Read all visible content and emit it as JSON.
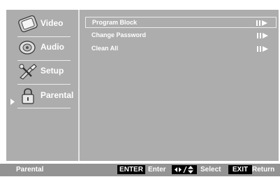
{
  "sidebar": {
    "items": [
      {
        "label": "Video",
        "icon": "tv-icon"
      },
      {
        "label": "Audio",
        "icon": "speaker-icon"
      },
      {
        "label": "Setup",
        "icon": "tools-icon"
      },
      {
        "label": "Parental",
        "icon": "lock-icon",
        "selected": true
      }
    ]
  },
  "main": {
    "rows": [
      {
        "label": "Program Block"
      },
      {
        "label": "Change Password"
      },
      {
        "label": "Clean All"
      }
    ]
  },
  "footer": {
    "title": "Parental",
    "enter_key": "ENTER",
    "enter_label": "Enter",
    "select_key": "◆▸/◆",
    "select_label": "Select",
    "exit_key": "EXIT",
    "return_label": "Return"
  },
  "colors": {
    "screen_bg": "#adadad",
    "footer_bg": "#939393",
    "text": "#ffffff"
  }
}
